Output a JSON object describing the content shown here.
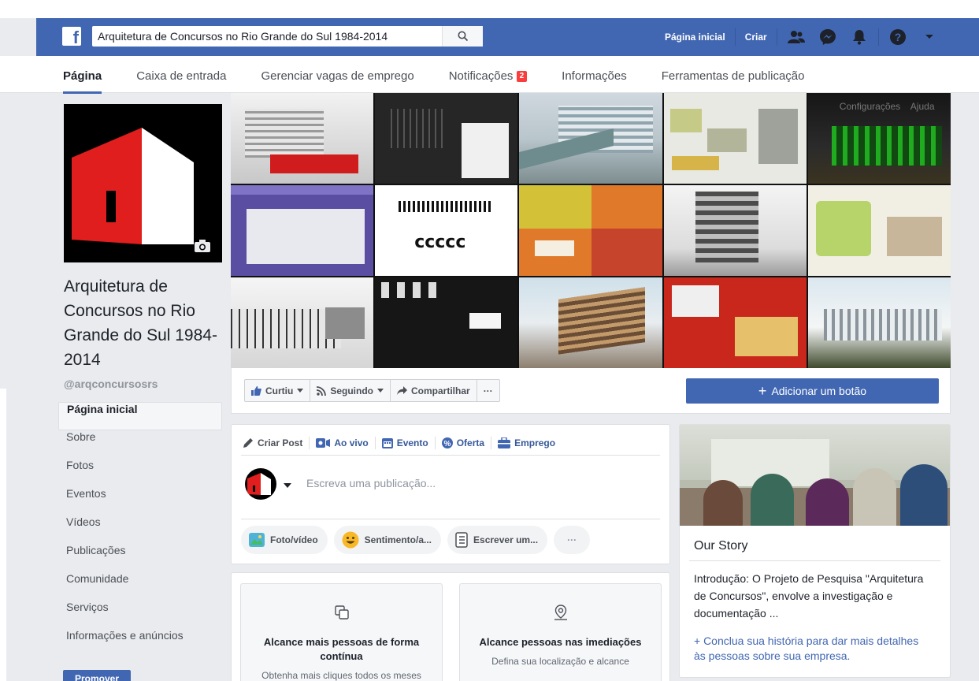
{
  "header": {
    "logo": "f",
    "search_value": "Arquitetura de Concursos no Rio Grande do Sul 1984-2014",
    "home_label": "Página inicial",
    "create_label": "Criar",
    "brand_color": "#4267b2"
  },
  "tabs": [
    {
      "label": "Página"
    },
    {
      "label": "Caixa de entrada"
    },
    {
      "label": "Gerenciar vagas de emprego"
    },
    {
      "label": "Notificações",
      "badge": "2"
    },
    {
      "label": "Informações"
    },
    {
      "label": "Ferramentas de publicação"
    }
  ],
  "page": {
    "title": "Arquitetura de Concursos no Rio Grande do Sul 1984-2014",
    "handle": "@arqconcursosrs"
  },
  "sidebar": {
    "items": [
      {
        "label": "Página inicial"
      },
      {
        "label": "Sobre"
      },
      {
        "label": "Fotos"
      },
      {
        "label": "Eventos"
      },
      {
        "label": "Vídeos"
      },
      {
        "label": "Publicações"
      },
      {
        "label": "Comunidade"
      },
      {
        "label": "Serviços"
      },
      {
        "label": "Informações e anúncios"
      }
    ],
    "promote_label": "Promover"
  },
  "cover_overlay": {
    "settings": "Configurações",
    "help": "Ajuda"
  },
  "actions": {
    "liked": "Curtiu",
    "following": "Seguindo",
    "share": "Compartilhar",
    "more": "···",
    "add_button": "Adicionar um botão"
  },
  "composer": {
    "tabs": [
      "Criar Post",
      "Ao vivo",
      "Evento",
      "Oferta",
      "Emprego"
    ],
    "placeholder": "Escreva uma publicação...",
    "pills": [
      "Foto/vídeo",
      "Sentimento/a...",
      "Escrever um...",
      "···"
    ]
  },
  "promos": [
    {
      "title": "Alcance mais pessoas de forma contínua",
      "subtitle": "Obtenha mais cliques todos os meses"
    },
    {
      "title": "Alcance pessoas nas imediações",
      "subtitle": "Defina sua localização e alcance"
    }
  ],
  "story": {
    "heading": "Our Story",
    "text": "Introdução: O Projeto de Pesquisa \"Arquitetura de Concursos\", envolve a investigação e documentação ...",
    "link": "+ Conclua sua história para dar mais detalhes às pessoas sobre sua empresa."
  }
}
